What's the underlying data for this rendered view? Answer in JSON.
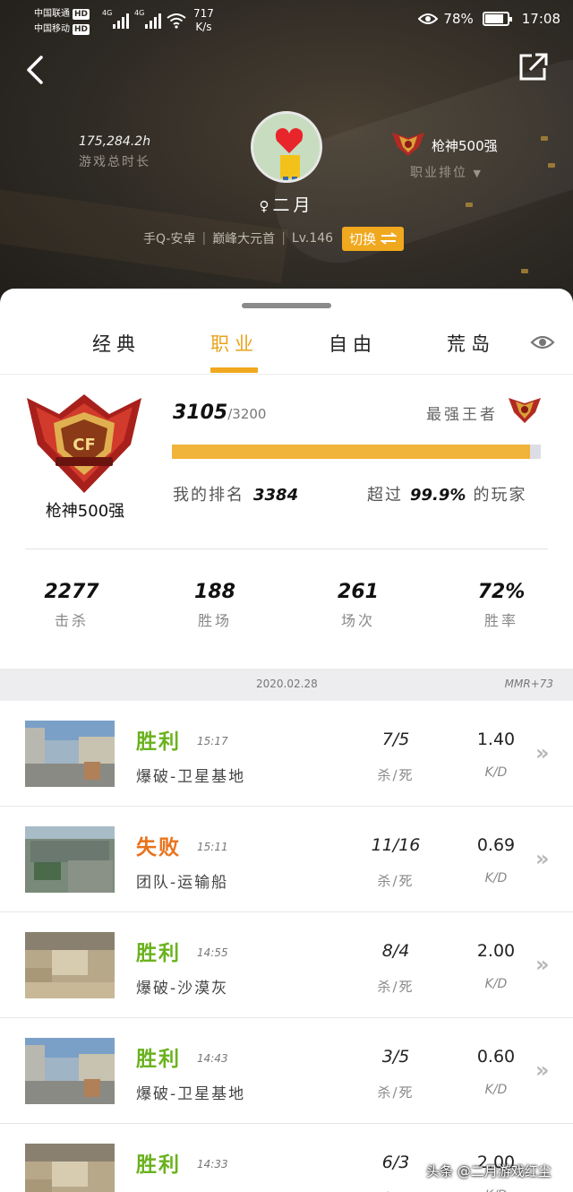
{
  "status_bar": {
    "carrier1": "中国联通",
    "carrier2": "中国移动",
    "hd_badge": "HD",
    "network1": "4G",
    "network2": "4G",
    "speed_value": "717",
    "speed_unit": "K/s",
    "battery": "78%",
    "time": "17:08"
  },
  "profile": {
    "play_time": "175,284.2h",
    "play_time_label": "游戏总时长",
    "username": "二月",
    "platform": "手Q-安卓",
    "server": "巅峰大元首",
    "level": "Lv.146",
    "switch_label": "切换",
    "rank_title": "枪神500强",
    "rank_label": "职业排位"
  },
  "tabs": [
    "经典",
    "职业",
    "自由",
    "荒岛"
  ],
  "active_tab": "职业",
  "rank_card": {
    "emblem_name": "枪神500强",
    "score": "3105",
    "score_max": "/3200",
    "progress": 0.97,
    "tier": "最强王者",
    "my_rank_label": "我的排名",
    "my_rank": "3384",
    "exceed_label": "超过",
    "exceed_value": "99.9%",
    "exceed_suffix": "的玩家"
  },
  "stats": [
    {
      "value": "2277",
      "label": "击杀"
    },
    {
      "value": "188",
      "label": "胜场"
    },
    {
      "value": "261",
      "label": "场次"
    },
    {
      "value": "72%",
      "label": "胜率"
    }
  ],
  "date_bar": {
    "date": "2020.02.28",
    "mmr": "MMR+73"
  },
  "kd_label": "杀/死",
  "ratio_label": "K/D",
  "matches": [
    {
      "result": "胜利",
      "outcome": "win",
      "time": "15:17",
      "mode": "爆破-卫星基地",
      "kd": "7/5",
      "ratio": "1.40"
    },
    {
      "result": "失败",
      "outcome": "lose",
      "time": "15:11",
      "mode": "团队-运输船",
      "kd": "11/16",
      "ratio": "0.69"
    },
    {
      "result": "胜利",
      "outcome": "win",
      "time": "14:55",
      "mode": "爆破-沙漠灰",
      "kd": "8/4",
      "ratio": "2.00"
    },
    {
      "result": "胜利",
      "outcome": "win",
      "time": "14:43",
      "mode": "爆破-卫星基地",
      "kd": "3/5",
      "ratio": "0.60"
    },
    {
      "result": "胜利",
      "outcome": "win",
      "time": "14:33",
      "mode": "",
      "kd": "6/3",
      "ratio": "2.00"
    }
  ],
  "watermark": "头条 @二月游戏红尘",
  "colors": {
    "accent": "#f0a81e",
    "win": "#6ab21e",
    "lose": "#e8721c"
  }
}
